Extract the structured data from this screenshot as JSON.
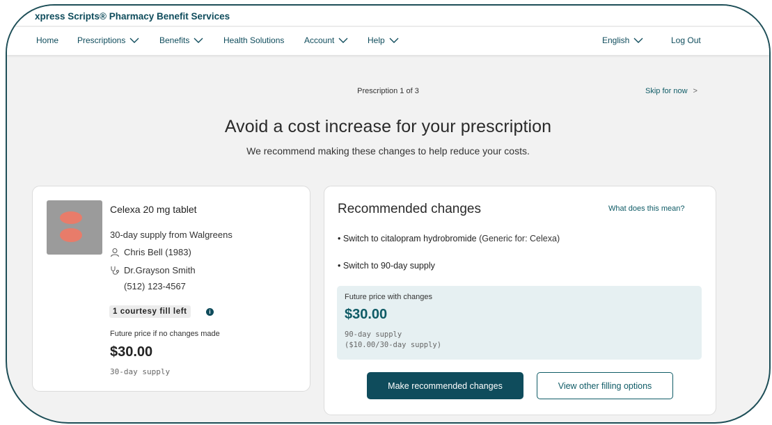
{
  "brand": {
    "title": "xpress Scripts® Pharmacy Benefit Services"
  },
  "nav": {
    "items": [
      {
        "label": "Home",
        "has_dropdown": false
      },
      {
        "label": "Prescriptions",
        "has_dropdown": true
      },
      {
        "label": "Benefits",
        "has_dropdown": true
      },
      {
        "label": "Health Solutions",
        "has_dropdown": false
      },
      {
        "label": "Account",
        "has_dropdown": true
      },
      {
        "label": "Help",
        "has_dropdown": true
      }
    ],
    "language": "English",
    "logout": "Log Out"
  },
  "progress": {
    "text": "Prescription 1 of 3",
    "skip": "Skip for now",
    "skip_arrow": ">"
  },
  "header": {
    "title": "Avoid a cost increase for your prescription",
    "subtitle": "We recommend making these changes to help reduce your costs."
  },
  "prescription": {
    "drug": "Celexa 20 mg tablet",
    "supply": "30-day supply from Walgreens",
    "patient": "Chris Bell (1983)",
    "doctor": "Dr.Grayson Smith",
    "phone": "(512) 123-4567",
    "courtesy": "1 courtesy fill left",
    "info": "i",
    "future_label": "Future price if no changes made",
    "future_price": "$30.00",
    "future_supply": "30-day supply"
  },
  "recommended": {
    "title": "Recommended changes",
    "link": "What does this mean?",
    "change1_bold": "• Switch to citalopram hydrobromide",
    "change1_note": "(Generic for: Celexa)",
    "change2": "• Switch to 90-day supply",
    "price_label": "Future price with changes",
    "price": "$30.00",
    "supply1": "90-day supply",
    "supply2": "($10.00/30-day supply)",
    "primary_button": "Make recommended changes",
    "secondary_button": "View other filling options"
  },
  "colors": {
    "brand": "#0f4c5c",
    "accent": "#0f5b66",
    "highlight_bg": "#e6f0f2",
    "pill": "#e87c6a"
  }
}
